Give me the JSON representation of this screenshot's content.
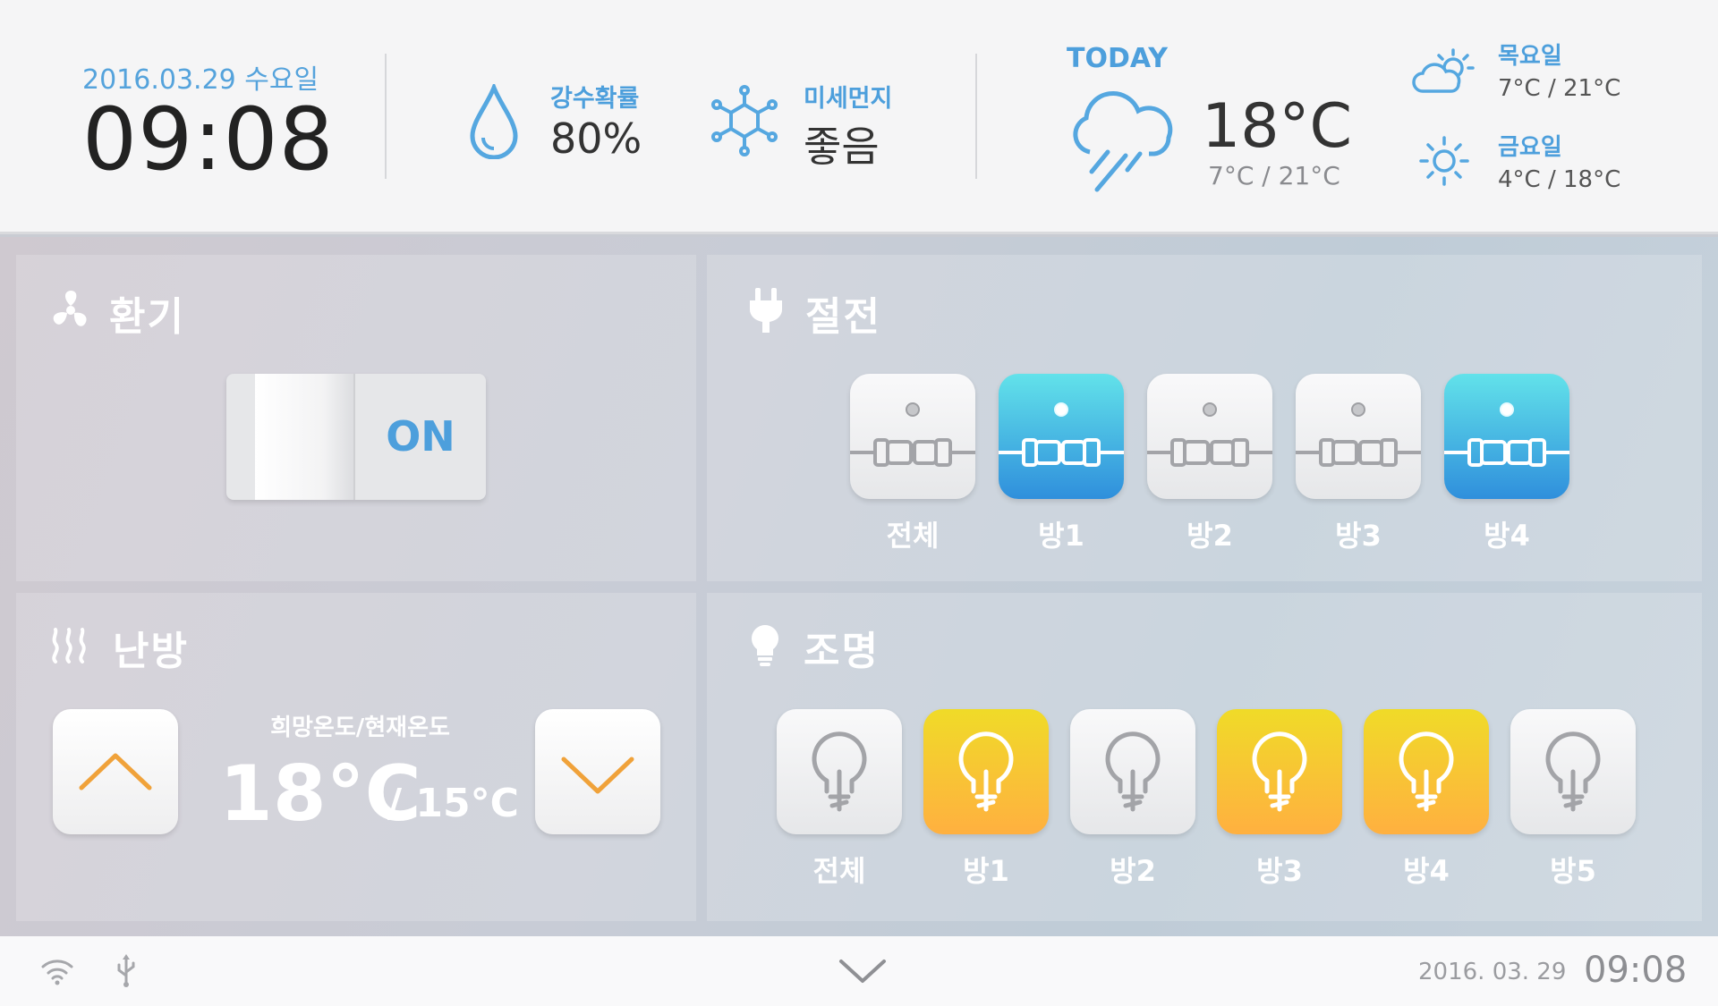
{
  "header": {
    "date": "2016.03.29 수요일",
    "time": "09:08",
    "rain": {
      "label": "강수확률",
      "value": "80%",
      "icon": "water-drop-icon"
    },
    "dust": {
      "label": "미세먼지",
      "value": "좋음",
      "icon": "dust-molecule-icon"
    },
    "today": {
      "label": "TODAY",
      "temp": "18°C",
      "minmax": "7°C / 21°C",
      "icon": "rain-cloud-icon"
    },
    "forecast": [
      {
        "day": "목요일",
        "temps": "7°C / 21°C",
        "icon": "partly-cloudy-icon"
      },
      {
        "day": "금요일",
        "temps": "4°C / 18°C",
        "icon": "sun-icon"
      }
    ]
  },
  "ventilation": {
    "title": "환기",
    "icon": "fan-icon",
    "switch_label": "ON",
    "switch_state": "on"
  },
  "power": {
    "title": "절전",
    "icon": "plug-icon",
    "tiles": [
      {
        "label": "전체",
        "active": false
      },
      {
        "label": "방1",
        "active": true
      },
      {
        "label": "방2",
        "active": false
      },
      {
        "label": "방3",
        "active": false
      },
      {
        "label": "방4",
        "active": true
      }
    ]
  },
  "heating": {
    "title": "난방",
    "icon": "heat-waves-icon",
    "label": "희망온도/현재온도",
    "target": "18°C",
    "current": "/ 15°C",
    "up_icon": "chevron-up-icon",
    "down_icon": "chevron-down-icon"
  },
  "lighting": {
    "title": "조명",
    "icon": "bulb-icon",
    "tiles": [
      {
        "label": "전체",
        "active": false
      },
      {
        "label": "방1",
        "active": true
      },
      {
        "label": "방2",
        "active": false
      },
      {
        "label": "방3",
        "active": true
      },
      {
        "label": "방4",
        "active": true
      },
      {
        "label": "방5",
        "active": false
      }
    ]
  },
  "footer": {
    "date": "2016. 03. 29",
    "time": "09:08",
    "icons": [
      "wifi-icon",
      "usb-icon"
    ],
    "expand_icon": "chevron-down-icon"
  },
  "colors": {
    "accent": "#4d9fdc",
    "plug_on": "#2f8fdc",
    "lamp_on": "#f5c22e",
    "arrow": "#f0a23a"
  }
}
